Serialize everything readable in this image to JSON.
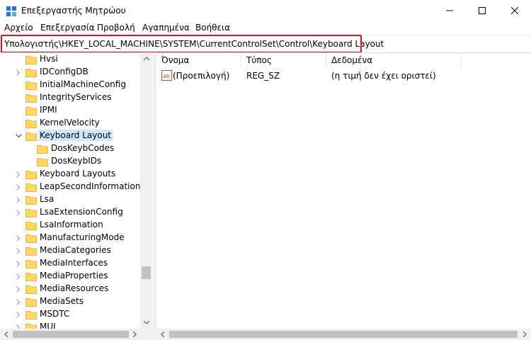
{
  "window": {
    "title": "Επεξεργαστής Μητρώου",
    "controls": {
      "minimize": "—",
      "maximize": "☐",
      "close": "✕"
    }
  },
  "menu": [
    "Αρχείο",
    "Επεξεργασία",
    "Προβολή",
    "Αγαπημένα",
    "Βοήθεια"
  ],
  "address": {
    "path": "Υπολογιστής\\HKEY_LOCAL_MACHINE\\SYSTEM\\CurrentControlSet\\Control\\Keyboard Layout",
    "highlight_color": "#e81123"
  },
  "tree": {
    "items": [
      {
        "label": "Hvsi",
        "expander": ""
      },
      {
        "label": "IDConfigDB",
        "expander": "›"
      },
      {
        "label": "InitialMachineConfig",
        "expander": ""
      },
      {
        "label": "IntegrityServices",
        "expander": ""
      },
      {
        "label": "IPMI",
        "expander": ""
      },
      {
        "label": "KernelVelocity",
        "expander": ""
      },
      {
        "label": "Keyboard Layout",
        "expander": "⌄",
        "selected": true
      },
      {
        "label": "DosKeybCodes",
        "expander": "",
        "child": true
      },
      {
        "label": "DosKeybIDs",
        "expander": "",
        "child": true
      },
      {
        "label": "Keyboard Layouts",
        "expander": "›"
      },
      {
        "label": "LeapSecondInformation",
        "expander": "›"
      },
      {
        "label": "Lsa",
        "expander": "›"
      },
      {
        "label": "LsaExtensionConfig",
        "expander": "›"
      },
      {
        "label": "LsaInformation",
        "expander": ""
      },
      {
        "label": "ManufacturingMode",
        "expander": "›"
      },
      {
        "label": "MediaCategories",
        "expander": "›"
      },
      {
        "label": "MediaInterfaces",
        "expander": "›"
      },
      {
        "label": "MediaProperties",
        "expander": "›"
      },
      {
        "label": "MediaResources",
        "expander": "›"
      },
      {
        "label": "MediaSets",
        "expander": "›"
      },
      {
        "label": "MSDTC",
        "expander": "›"
      },
      {
        "label": "MUI",
        "expander": "›"
      }
    ],
    "selected_bg": "#cce8ff"
  },
  "list": {
    "columns": [
      "Όνομα",
      "Τύπος",
      "Δεδομένα"
    ],
    "rows": [
      {
        "name": "(Προεπιλογή)",
        "type": "REG_SZ",
        "data": "(η τιμή δεν έχει οριστεί)",
        "icon": "string-value-icon"
      }
    ]
  },
  "scroll": {
    "up": "▲",
    "down": "▼",
    "left": "◀",
    "right": "▶"
  },
  "colors": {
    "folder": "#ffd767",
    "folder_dark": "#e8b83a",
    "app_icon": "#1e78d7"
  }
}
